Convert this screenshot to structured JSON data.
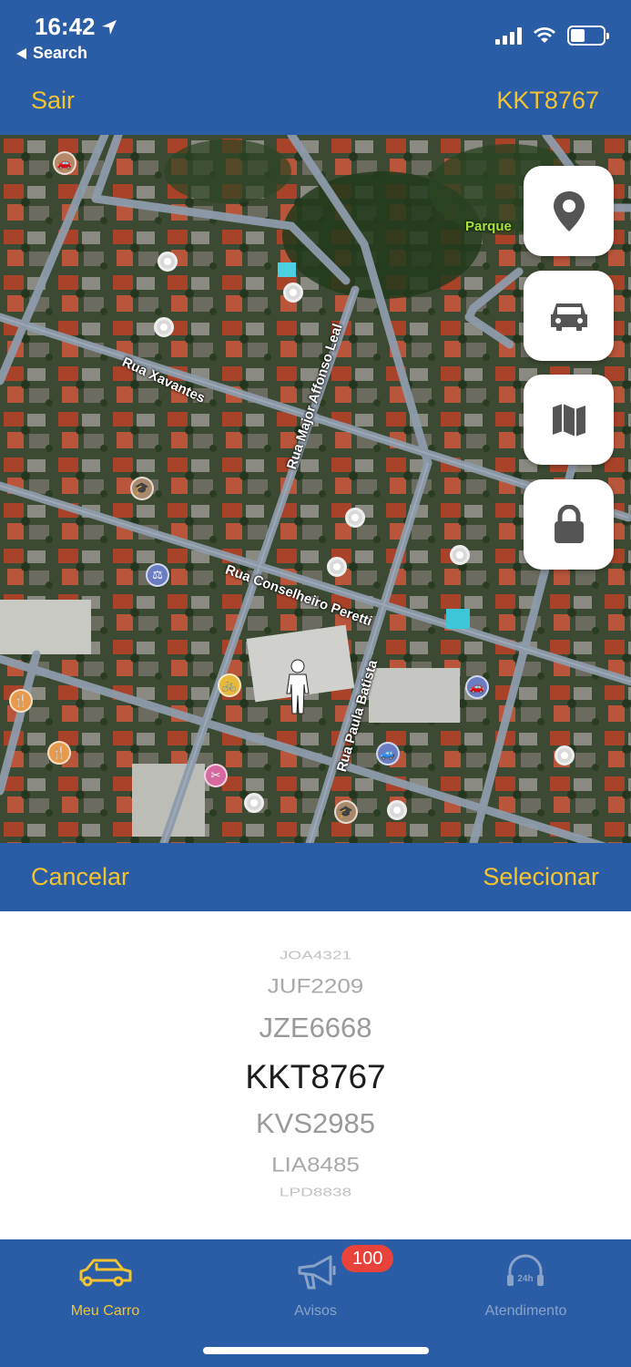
{
  "status_bar": {
    "time": "16:42",
    "back_label": "Search"
  },
  "nav": {
    "left_label": "Sair",
    "right_label": "KKT8767"
  },
  "map": {
    "street_labels": [
      "Rua Xavantes",
      "Rua Major Affonso Leal",
      "Rua Conselheiro Peretti",
      "Rua Paula Batista"
    ],
    "park_label": "Parque"
  },
  "map_buttons": [
    {
      "name": "location-pin-button",
      "icon": "location-pin-icon"
    },
    {
      "name": "car-button",
      "icon": "car-icon"
    },
    {
      "name": "map-button",
      "icon": "map-icon"
    },
    {
      "name": "lock-button",
      "icon": "lock-icon"
    }
  ],
  "picker_toolbar": {
    "cancel_label": "Cancelar",
    "select_label": "Selecionar"
  },
  "picker": {
    "items": [
      "JOA4321",
      "JUF2209",
      "JZE6668",
      "KKT8767",
      "KVS2985",
      "LIA8485",
      "LPD8838"
    ],
    "selected": "KKT8767"
  },
  "tabbar": {
    "tabs": [
      {
        "label": "Meu Carro",
        "icon": "car-outline-icon",
        "active": true
      },
      {
        "label": "Avisos",
        "icon": "megaphone-icon",
        "active": false
      },
      {
        "label": "Atendimento",
        "icon": "headset-24h-icon",
        "active": false
      }
    ],
    "badge": "100"
  },
  "colors": {
    "primary": "#2a5da6",
    "accent": "#f4c430",
    "badge": "#e8423b",
    "inactive_tab": "#8aa3c8"
  }
}
